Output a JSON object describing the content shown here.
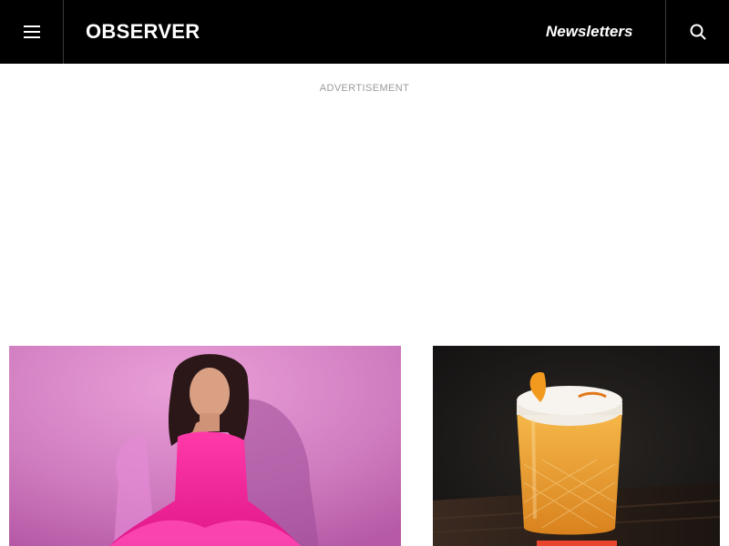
{
  "header": {
    "logo": "OBSERVER",
    "newsletters_label": "Newsletters",
    "menu_icon": "hamburger-menu-icon",
    "search_icon": "search-icon",
    "background": "#000000",
    "text_color": "#ffffff"
  },
  "ad": {
    "label": "ADVERTISEMENT"
  },
  "cards": [
    {
      "image": "woman-in-pink-dress-photo",
      "background": "#d579c0"
    },
    {
      "image": "cocktail-glass-photo",
      "background": "#1e1b19",
      "tag_color": "#e9442e"
    }
  ]
}
